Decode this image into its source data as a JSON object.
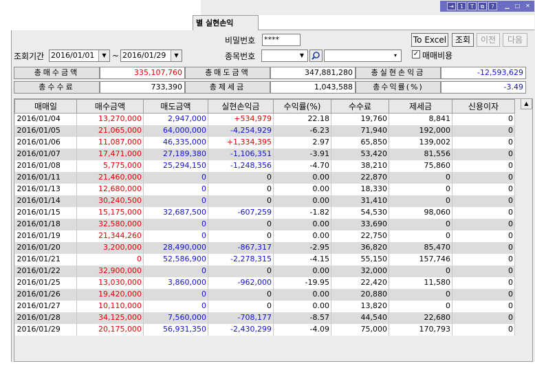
{
  "titlebar": {
    "icons": [
      "exit-icon",
      "info-icon",
      "text-icon",
      "copy-icon",
      "help-icon",
      "minimize-icon",
      "restore-icon",
      "close-icon"
    ]
  },
  "tab": {
    "label": "별 실현손익"
  },
  "form": {
    "password_label": "비밀번호",
    "password_value": "****",
    "period_label": "조회기간",
    "date_from": "2016/01/01",
    "tilde": "~",
    "date_to": "2016/01/29",
    "stock_label": "종목번호",
    "stock_code": "",
    "stock_name": "",
    "fee_checkbox_label": "매매비용",
    "fee_checked": true
  },
  "buttons": {
    "excel": "To Excel",
    "query": "조회",
    "prev": "이전",
    "next": "다음"
  },
  "summary": {
    "buy_label": "총매수금액",
    "buy_value": "335,107,760",
    "sell_label": "총매도금액",
    "sell_value": "347,881,280",
    "pnl_label": "총실현손익금",
    "pnl_value": "-12,593,629",
    "fee_label": "총수수료",
    "fee_value": "733,390",
    "tax_label": "총제세금",
    "tax_value": "1,043,588",
    "rate_label": "총수익률(%)",
    "rate_value": "-3.49"
  },
  "table": {
    "columns": [
      "매매일",
      "매수금액",
      "매도금액",
      "실현손익금",
      "수익률(%)",
      "수수료",
      "제세금",
      "신용이자"
    ],
    "rows": [
      [
        "2016/01/04",
        "13,270,000",
        "2,947,000",
        "+534,979",
        "22.18",
        "19,760",
        "8,841",
        "0"
      ],
      [
        "2016/01/05",
        "21,065,000",
        "64,000,000",
        "-4,254,929",
        "-6.23",
        "71,940",
        "192,000",
        "0"
      ],
      [
        "2016/01/06",
        "11,087,000",
        "46,335,000",
        "+1,334,395",
        "2.97",
        "65,850",
        "139,002",
        "0"
      ],
      [
        "2016/01/07",
        "17,471,000",
        "27,189,380",
        "-1,106,351",
        "-3.91",
        "53,420",
        "81,556",
        "0"
      ],
      [
        "2016/01/08",
        "5,775,000",
        "25,294,150",
        "-1,248,356",
        "-4.70",
        "38,210",
        "75,860",
        "0"
      ],
      [
        "2016/01/11",
        "21,460,000",
        "0",
        "0",
        "0.00",
        "22,870",
        "0",
        "0"
      ],
      [
        "2016/01/13",
        "12,680,000",
        "0",
        "0",
        "0.00",
        "18,330",
        "0",
        "0"
      ],
      [
        "2016/01/14",
        "30,240,500",
        "0",
        "0",
        "0.00",
        "31,410",
        "0",
        "0"
      ],
      [
        "2016/01/15",
        "15,175,000",
        "32,687,500",
        "-607,259",
        "-1.82",
        "54,530",
        "98,060",
        "0"
      ],
      [
        "2016/01/18",
        "32,580,000",
        "0",
        "0",
        "0.00",
        "33,690",
        "0",
        "0"
      ],
      [
        "2016/01/19",
        "21,344,260",
        "0",
        "0",
        "0.00",
        "22,750",
        "0",
        "0"
      ],
      [
        "2016/01/20",
        "3,200,000",
        "28,490,000",
        "-867,317",
        "-2.95",
        "36,820",
        "85,470",
        "0"
      ],
      [
        "2016/01/21",
        "0",
        "52,586,900",
        "-2,278,315",
        "-4.15",
        "55,150",
        "157,746",
        "0"
      ],
      [
        "2016/01/22",
        "32,900,000",
        "0",
        "0",
        "0.00",
        "32,000",
        "0",
        "0"
      ],
      [
        "2016/01/25",
        "13,030,000",
        "3,860,000",
        "-962,000",
        "-19.95",
        "22,420",
        "11,580",
        "0"
      ],
      [
        "2016/01/26",
        "19,420,000",
        "0",
        "0",
        "0.00",
        "20,880",
        "0",
        "0"
      ],
      [
        "2016/01/27",
        "10,110,000",
        "0",
        "0",
        "0.00",
        "13,820",
        "0",
        "0"
      ],
      [
        "2016/01/28",
        "34,125,000",
        "7,560,000",
        "-708,177",
        "-8.57",
        "44,540",
        "22,680",
        "0"
      ],
      [
        "2016/01/29",
        "20,175,000",
        "56,931,350",
        "-2,430,299",
        "-4.09",
        "75,000",
        "170,793",
        "0"
      ]
    ]
  },
  "colors": {
    "title_bar": "#6b6dc2",
    "buy": "#e00000",
    "sell": "#1010d0",
    "row_alt": "#dcdcdc"
  }
}
